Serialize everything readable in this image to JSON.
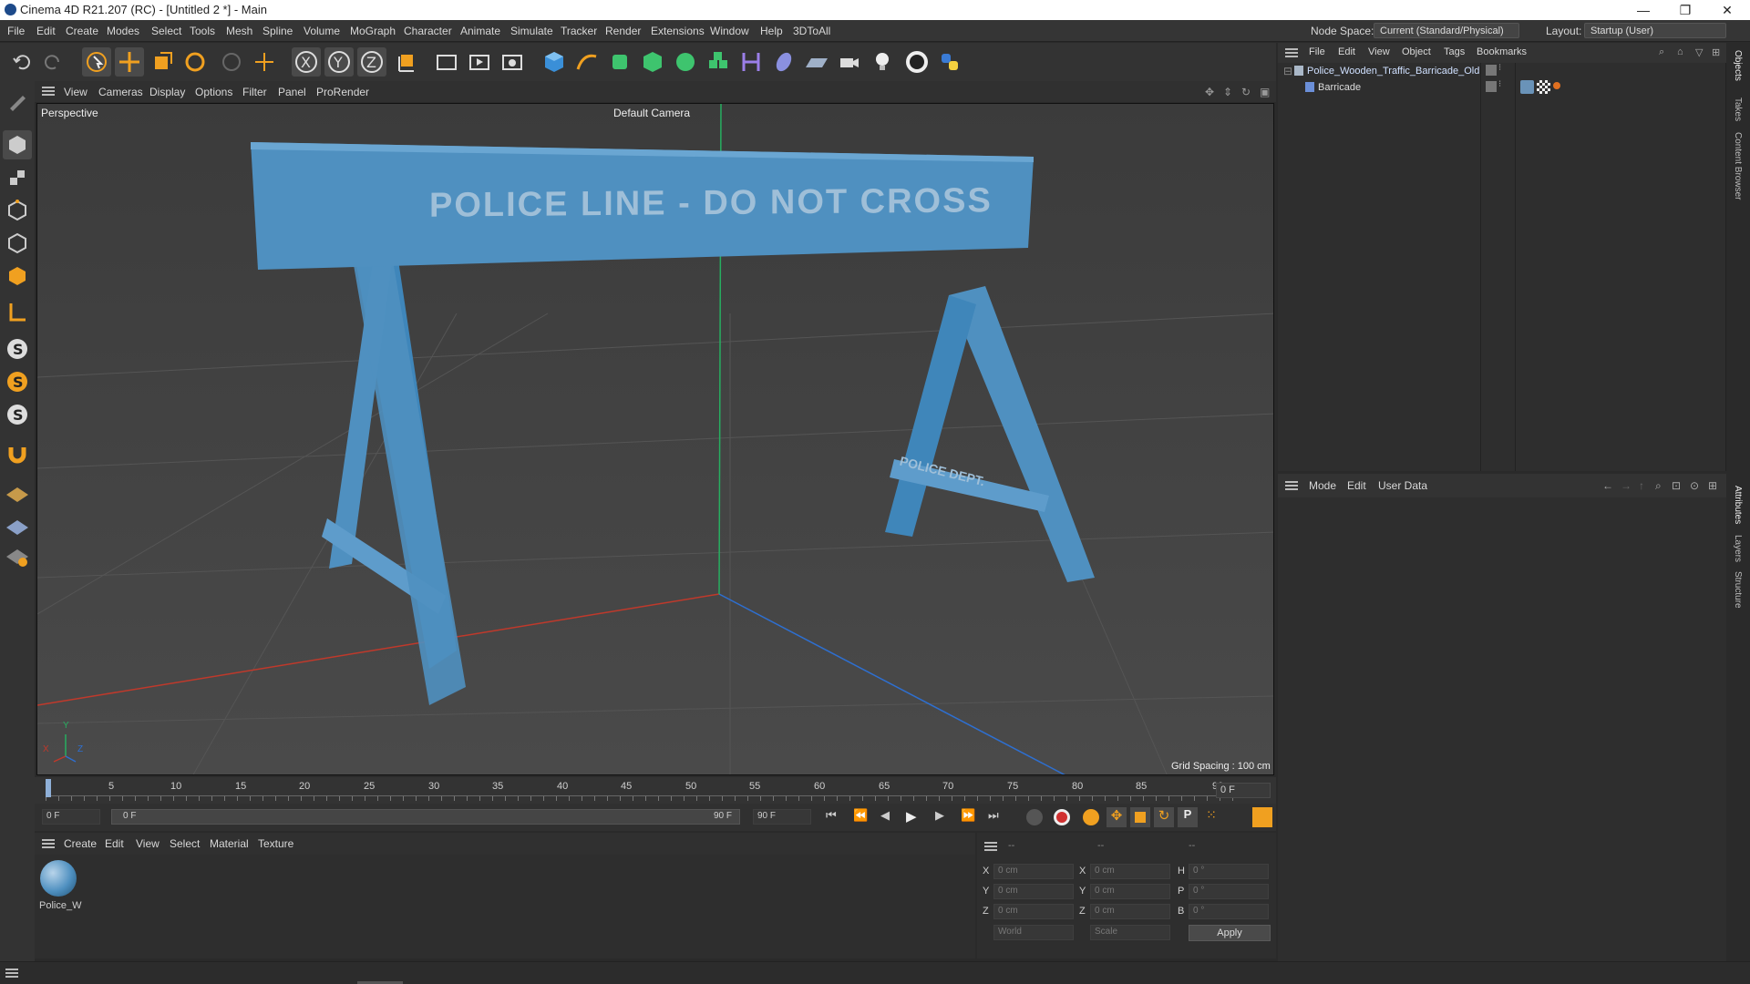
{
  "window": {
    "title": "Cinema 4D R21.207 (RC) - [Untitled 2 *] - Main",
    "min": "—",
    "max": "❐",
    "close": "✕"
  },
  "menubar": {
    "items": [
      "File",
      "Edit",
      "Create",
      "Modes",
      "Select",
      "Tools",
      "Mesh",
      "Spline",
      "Volume",
      "MoGraph",
      "Character",
      "Animate",
      "Simulate",
      "Tracker",
      "Render",
      "Extensions",
      "Window",
      "Help",
      "3DToAll"
    ],
    "node_space_label": "Node Space:",
    "node_space_value": "Current (Standard/Physical)",
    "layout_label": "Layout:",
    "layout_value": "Startup (User)"
  },
  "viewport_menu": [
    "View",
    "Cameras",
    "Display",
    "Options",
    "Filter",
    "Panel",
    "ProRender"
  ],
  "viewport": {
    "projection": "Perspective",
    "camera": "Default Camera",
    "grid_spacing": "Grid Spacing : 100 cm",
    "sign_text": "POLICE LINE - DO NOT CROSS",
    "crossbar_text": "POLICE DEPT.",
    "axis_x": "X",
    "axis_y": "Y",
    "axis_z": "Z"
  },
  "timeline": {
    "ticks": [
      "0",
      "5",
      "10",
      "15",
      "20",
      "25",
      "30",
      "35",
      "40",
      "45",
      "50",
      "55",
      "60",
      "65",
      "70",
      "75",
      "80",
      "85",
      "90"
    ],
    "current_frame": "0 F",
    "start_frame": "0 F",
    "range_start": "0 F",
    "range_end": "90 F",
    "end_frame": "90 F"
  },
  "material_menu": [
    "Create",
    "Edit",
    "View",
    "Select",
    "Material",
    "Texture"
  ],
  "material": {
    "name": "Police_W"
  },
  "coords": {
    "col1_header": "--",
    "col2_header": "--",
    "col3_header": "--",
    "rows": [
      {
        "a": "X",
        "av": "0 cm",
        "b": "X",
        "bv": "0 cm",
        "c": "H",
        "cv": "0 °"
      },
      {
        "a": "Y",
        "av": "0 cm",
        "b": "Y",
        "bv": "0 cm",
        "c": "P",
        "cv": "0 °"
      },
      {
        "a": "Z",
        "av": "0 cm",
        "b": "Z",
        "bv": "0 cm",
        "c": "B",
        "cv": "0 °"
      }
    ],
    "world": "World",
    "scale": "Scale",
    "apply": "Apply"
  },
  "object_manager": {
    "menu": [
      "File",
      "Edit",
      "View",
      "Object",
      "Tags",
      "Bookmarks"
    ],
    "objects": [
      {
        "name": "Police_Wooden_Traffic_Barricade_Old"
      },
      {
        "name": "Barricade"
      }
    ]
  },
  "attributes": {
    "menu": [
      "Mode",
      "Edit",
      "User Data"
    ]
  },
  "side_tabs": [
    "Objects",
    "Takes",
    "Content Browser",
    "Attributes",
    "Layers",
    "Structure"
  ],
  "colors": {
    "accent": "#f0a020",
    "barricade": "#4f90c0",
    "x_axis": "#c0392b",
    "y_axis": "#27ae60",
    "z_axis": "#2e6fd0"
  }
}
